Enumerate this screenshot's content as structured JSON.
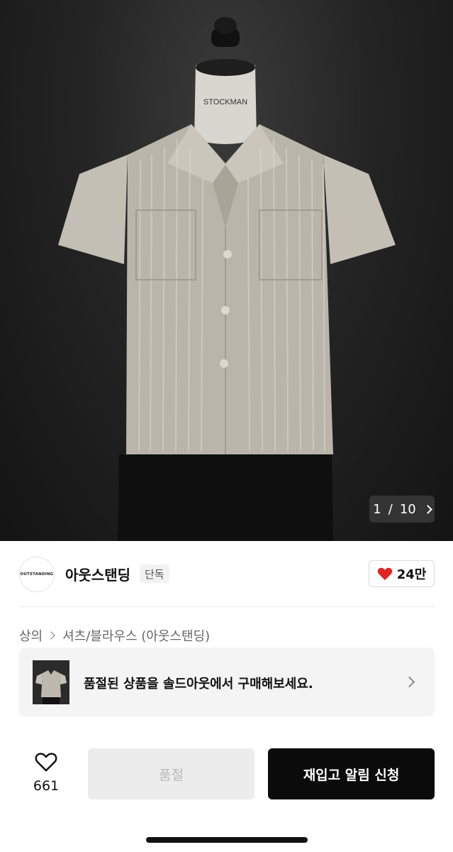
{
  "product_image": {
    "mannequin_label": "STOCKMAN",
    "pager": {
      "current": "1",
      "separator": "/",
      "total": "10"
    }
  },
  "brand": {
    "logo_text": "OUTSTANDING",
    "name": "아웃스탠딩",
    "badge": "단독"
  },
  "likes": {
    "count": "24만",
    "icon": "heart-filled-icon",
    "color": "#e02424"
  },
  "breadcrumb": {
    "items": [
      "상의",
      "셔츠/블라우스 (아웃스탠딩)"
    ]
  },
  "promo": {
    "text": "품절된 상품을 솔드아웃에서 구매해보세요.",
    "icon": "chevron-right-icon"
  },
  "bottom_bar": {
    "wishlist_count": "661",
    "soldout_label": "품절",
    "restock_label": "재입고 알림 신청"
  }
}
